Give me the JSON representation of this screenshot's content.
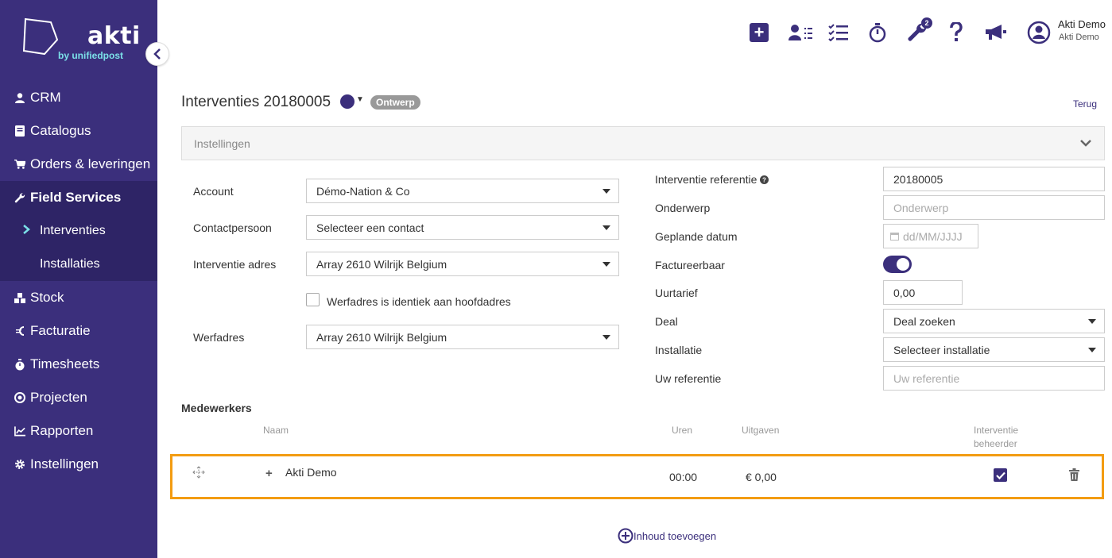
{
  "brand": {
    "name": "akti",
    "tagline": "by unifiedpost"
  },
  "sidebar": {
    "items": [
      {
        "label": "CRM",
        "icon": "user-icon"
      },
      {
        "label": "Catalogus",
        "icon": "book-icon"
      },
      {
        "label": "Orders & leveringen",
        "icon": "cart-icon"
      },
      {
        "label": "Field Services",
        "icon": "wrench-icon"
      },
      {
        "label": "Interventies",
        "icon": "chevron-right-icon"
      },
      {
        "label": "Installaties",
        "icon": ""
      },
      {
        "label": "Stock",
        "icon": "cubes-icon"
      },
      {
        "label": "Facturatie",
        "icon": "euro-icon"
      },
      {
        "label": "Timesheets",
        "icon": "stopwatch-icon"
      },
      {
        "label": "Projecten",
        "icon": "target-icon"
      },
      {
        "label": "Rapporten",
        "icon": "chart-icon"
      },
      {
        "label": "Instellingen",
        "icon": "gear-icon"
      }
    ]
  },
  "topbar": {
    "tools_badge": "2",
    "user_name": "Akti Demo",
    "user_company": "Akti Demo"
  },
  "header": {
    "title": "Interventies 20180005",
    "status": "Ontwerp",
    "back": "Terug"
  },
  "panel": {
    "title": "Instellingen"
  },
  "form_left": {
    "account_label": "Account",
    "account_value": "Démo-Nation & Co",
    "contact_label": "Contactpersoon",
    "contact_value": "Selecteer een contact",
    "address_label": "Interventie adres",
    "address_value": "Array 2610 Wilrijk Belgium",
    "same_address_label": "Werfadres is identiek aan hoofdadres",
    "werfadres_label": "Werfadres",
    "werfadres_value": "Array 2610 Wilrijk Belgium"
  },
  "form_right": {
    "ref_label": "Interventie referentie",
    "ref_value": "20180005",
    "subject_label": "Onderwerp",
    "subject_placeholder": "Onderwerp",
    "date_label": "Geplande datum",
    "date_placeholder": "dd/MM/JJJJ",
    "billable_label": "Factureerbaar",
    "hourly_label": "Uurtarief",
    "hourly_value": "0,00",
    "deal_label": "Deal",
    "deal_value": "Deal zoeken",
    "installation_label": "Installatie",
    "installation_value": "Selecteer installatie",
    "your_ref_label": "Uw referentie",
    "your_ref_placeholder": "Uw referentie"
  },
  "medewerkers": {
    "title": "Medewerkers",
    "col_name": "Naam",
    "col_hours": "Uren",
    "col_expenses": "Uitgaven",
    "col_manager_1": "Interventie",
    "col_manager_2": "beheerder",
    "rows": [
      {
        "name": "Akti Demo",
        "hours": "00:00",
        "expenses": "€ 0,00",
        "manager": true
      }
    ],
    "add_content": "Inhoud toevoegen"
  },
  "colors": {
    "brand": "#3b2f7c",
    "accent": "#7be0e8",
    "highlight": "#f39c12"
  }
}
